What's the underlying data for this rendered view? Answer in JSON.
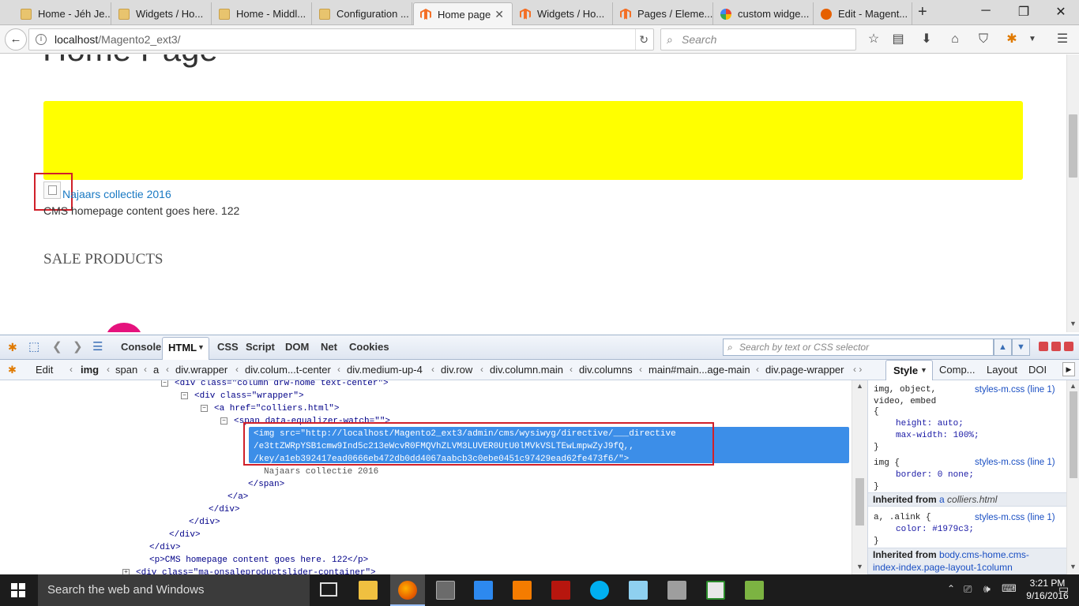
{
  "browser": {
    "tabs": [
      {
        "label": "Home - Jéh Je...",
        "icon": "folder-icon",
        "active": false
      },
      {
        "label": "Widgets / Ho...",
        "icon": "folder-icon",
        "active": false
      },
      {
        "label": "Home - Middl...",
        "icon": "folder-icon",
        "active": false
      },
      {
        "label": "Configuration ...",
        "icon": "folder-icon",
        "active": false
      },
      {
        "label": "Home page",
        "icon": "magento-icon",
        "active": true
      },
      {
        "label": "Widgets / Ho...",
        "icon": "magento-icon",
        "active": false
      },
      {
        "label": "Pages / Eleme...",
        "icon": "magento-icon",
        "active": false
      },
      {
        "label": "custom widge...",
        "icon": "google-icon",
        "active": false
      },
      {
        "label": "Edit - Magent...",
        "icon": "firefox-icon",
        "active": false
      }
    ],
    "new_tab": "+",
    "url_host": "localhost",
    "url_path": "/Magento2_ext3/",
    "search_placeholder": "Search"
  },
  "page": {
    "heading": "Home Page",
    "banner_color": "#ffff00",
    "link_text": "Najaars collectie 2016",
    "link_color": "#1979c3",
    "content_text": "CMS homepage content goes here. 122",
    "sale_heading": "SALE PRODUCTS"
  },
  "firebug": {
    "tabs": [
      "Console",
      "HTML",
      "CSS",
      "Script",
      "DOM",
      "Net",
      "Cookies"
    ],
    "active_tab": "HTML",
    "search_placeholder": "Search by text or CSS selector",
    "edit_label": "Edit",
    "breadcrumbs": [
      "img",
      "span",
      "a",
      "div.wrapper",
      "div.colum...t-center",
      "div.medium-up-4",
      "div.row",
      "div.column.main",
      "div.columns",
      "main#main...age-main",
      "div.page-wrapper"
    ],
    "side_tabs": [
      "Style",
      "Comp...",
      "Layout",
      "DOI"
    ],
    "html_lines": [
      {
        "toggle": "minus",
        "text": "<div class=\"column drw-home text-center\">"
      },
      {
        "toggle": "minus",
        "text": "<div class=\"wrapper\">"
      },
      {
        "toggle": "minus",
        "text": "<a href=\"colliers.html\">"
      },
      {
        "toggle": "minus",
        "text": "<span data-equalizer-watch=\"\">"
      },
      {
        "toggle": "",
        "text": "<img src=\"http://localhost/Magento2_ext3/admin/cms/wysiwyg/directive/___directive"
      },
      {
        "toggle": "",
        "text": "/e3ttZWRpYSB1cmw9Ind5c213eWcvR0FMQVhZLVM3LUVER0UtU0lMVkVSLTEwLmpwZyJ9fQ,,"
      },
      {
        "toggle": "",
        "text": "/key/a1eb392417ead0666eb472db0dd4067aabcb3c0ebe0451c97429ead62fe473f6/\">"
      },
      {
        "toggle": "",
        "text": "Najaars collectie 2016"
      },
      {
        "toggle": "",
        "text": "</span>"
      },
      {
        "toggle": "",
        "text": "</a>"
      },
      {
        "toggle": "",
        "text": "</div>"
      },
      {
        "toggle": "",
        "text": "</div>"
      },
      {
        "toggle": "",
        "text": "</div>"
      },
      {
        "toggle": "",
        "text": "</div>"
      },
      {
        "toggle": "",
        "text": "<p>CMS homepage content goes here. 122</p>"
      },
      {
        "toggle": "plus",
        "text": "<div class=\"ma-onsaleproductslider-container\">"
      }
    ],
    "styles": {
      "rule1_selector_a": "img, object,",
      "rule1_selector_b": "video, embed",
      "rule1_source": "styles-m.css (line 1)",
      "rule1_open": "{",
      "rule1_prop1": "height: auto;",
      "rule1_prop2": "max-width: 100%;",
      "rule1_close": "}",
      "rule2_selector": "img {",
      "rule2_source": "styles-m.css (line 1)",
      "rule2_prop1": "border: 0 none;",
      "rule2_close": "}",
      "inherited1_label": "Inherited from",
      "inherited1_tag": "a",
      "inherited1_file": "colliers.html",
      "rule3_selector": "a, .alink {",
      "rule3_source": "styles-m.css (line 1)",
      "rule3_prop1": "color: #1979c3;",
      "rule3_close": "}",
      "inherited2_label": "Inherited from",
      "inherited2_text": "body.cms-home.cms-",
      "inherited2_text2": "index-index.page-layout-1column"
    }
  },
  "taskbar": {
    "search_text": "Search the web and Windows",
    "time": "3:21 PM",
    "date": "9/16/2016"
  },
  "colors": {
    "annotation_red": "#d0202a",
    "selection_blue": "#3c8ee8"
  }
}
